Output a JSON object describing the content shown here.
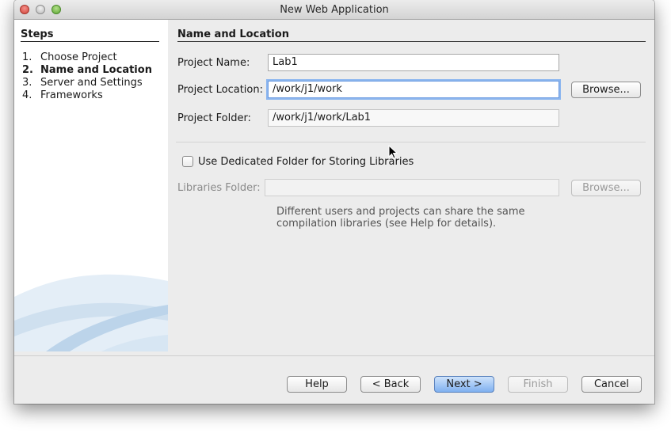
{
  "window": {
    "title": "New Web Application"
  },
  "steps": {
    "title": "Steps",
    "items": [
      {
        "num": "1.",
        "label": "Choose Project"
      },
      {
        "num": "2.",
        "label": "Name and Location"
      },
      {
        "num": "3.",
        "label": "Server and Settings"
      },
      {
        "num": "4.",
        "label": "Frameworks"
      }
    ],
    "current_index": 1
  },
  "form": {
    "section_title": "Name and Location",
    "project_name": {
      "label": "Project Name:",
      "value": "Lab1"
    },
    "project_location": {
      "label": "Project Location:",
      "value": "/work/j1/work",
      "browse_label": "Browse..."
    },
    "project_folder": {
      "label": "Project Folder:",
      "value": "/work/j1/work/Lab1"
    },
    "dedicated_folder": {
      "label": "Use Dedicated Folder for Storing Libraries",
      "checked": false
    },
    "libraries_folder": {
      "label": "Libraries Folder:",
      "value": "",
      "browse_label": "Browse..."
    },
    "help_lines": [
      "Different users and projects can share the same",
      "compilation libraries (see Help for details)."
    ]
  },
  "buttons": {
    "help": "Help",
    "back": "< Back",
    "next": "Next >",
    "finish": "Finish",
    "cancel": "Cancel"
  },
  "colors": {
    "accent_focus": "#6a9ae0",
    "primary_button": "#7fb0f0",
    "close_button": "#d0453b",
    "zoom_button": "#5ca532"
  }
}
